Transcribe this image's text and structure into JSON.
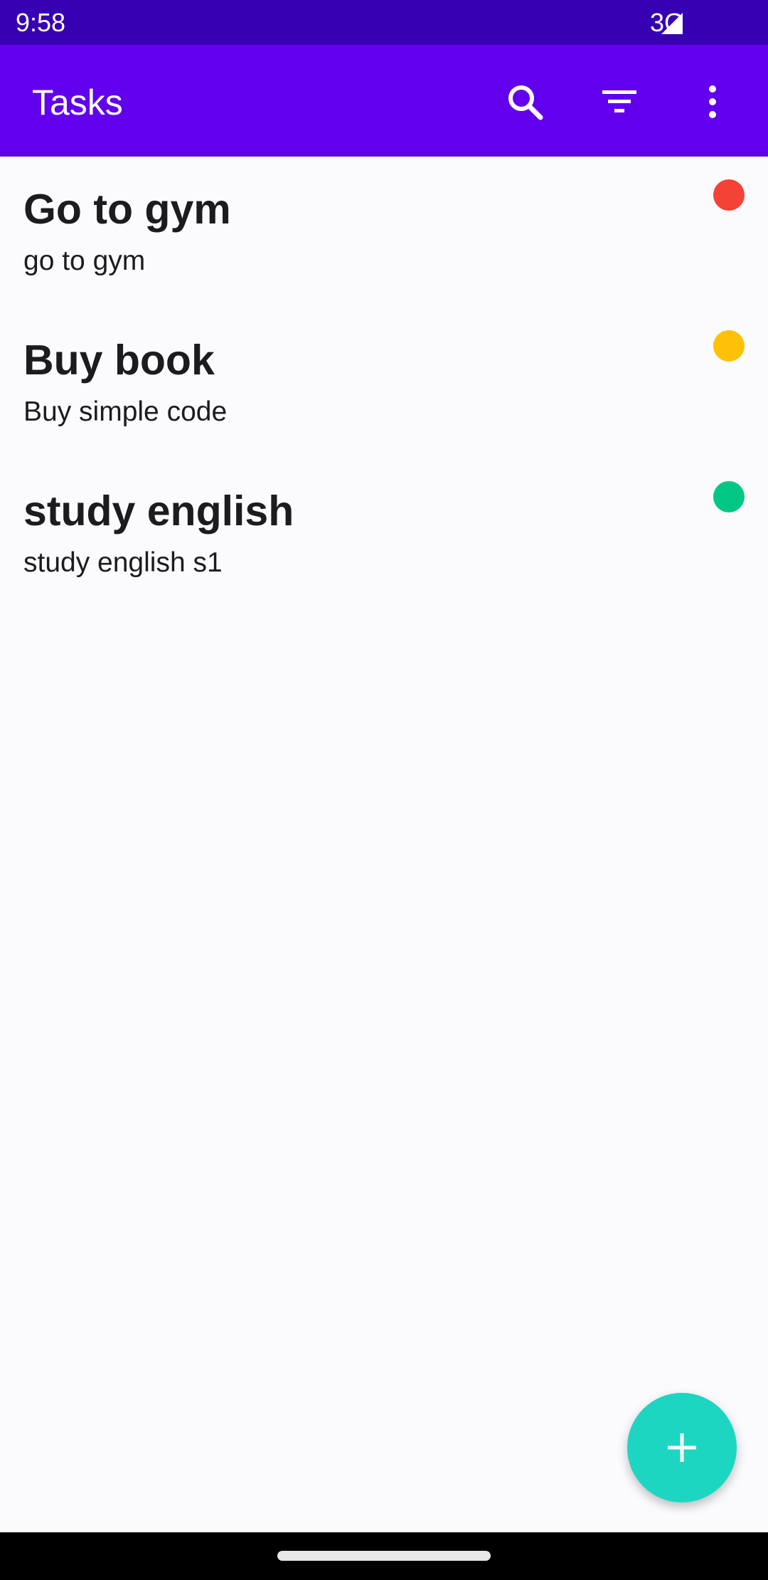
{
  "status_bar": {
    "time": "9:58",
    "network": "3G"
  },
  "app_bar": {
    "title": "Tasks",
    "actions": [
      "search-icon",
      "filter-icon",
      "more-vert-icon"
    ]
  },
  "tasks": [
    {
      "title": "Go to gym",
      "description": "go to gym",
      "priority_color": "#f44336"
    },
    {
      "title": "Buy book",
      "description": "Buy simple code",
      "priority_color": "#ffc107"
    },
    {
      "title": "study english",
      "description": "study english s1",
      "priority_color": "#00c884"
    }
  ],
  "fab": {
    "icon": "add-icon",
    "color": "#1dd6c2"
  },
  "colors": {
    "status_bar": "#3700b3",
    "app_bar": "#6200ee",
    "background": "#fbfbfe"
  }
}
